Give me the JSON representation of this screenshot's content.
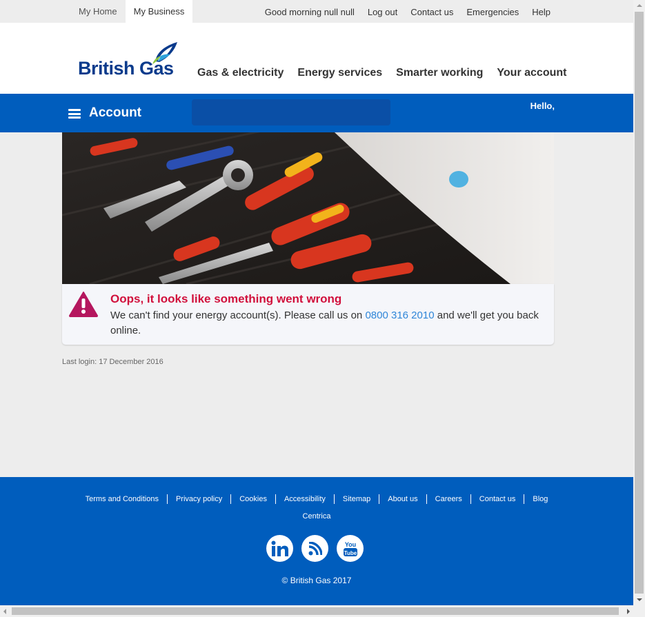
{
  "topbar": {
    "tabs": [
      {
        "label": "My Home",
        "active": false
      },
      {
        "label": "My Business",
        "active": true
      }
    ],
    "greeting": "Good morning null null",
    "links": [
      "Log out",
      "Contact us",
      "Emergencies",
      "Help"
    ]
  },
  "header": {
    "brand": "British Gas",
    "nav": [
      "Gas & electricity",
      "Energy services",
      "Smarter working",
      "Your account"
    ]
  },
  "account_bar": {
    "title": "Account",
    "hello": "Hello,"
  },
  "hero": {
    "icon": "tools-photo"
  },
  "error": {
    "title": "Oops, it looks like something went wrong",
    "message_before": "We can't find your energy account(s). Please call us on ",
    "phone": "0800 316 2010",
    "message_after": " and we'll get you back online."
  },
  "last_login": "Last login: 17 December 2016",
  "footer": {
    "links": [
      "Terms and Conditions",
      "Privacy policy",
      "Cookies",
      "Accessibility",
      "Sitemap",
      "About us",
      "Careers",
      "Contact us",
      "Blog"
    ],
    "centrica": "Centrica",
    "socials": [
      "linkedin-icon",
      "rss-icon",
      "youtube-icon"
    ],
    "copyright": "© British Gas 2017"
  },
  "colors": {
    "brand_blue": "#005dbd",
    "error_red": "#d1103c",
    "warning_magenta": "#b5175e",
    "link_blue": "#2f86d8",
    "logo_navy": "#0b3b8c"
  }
}
